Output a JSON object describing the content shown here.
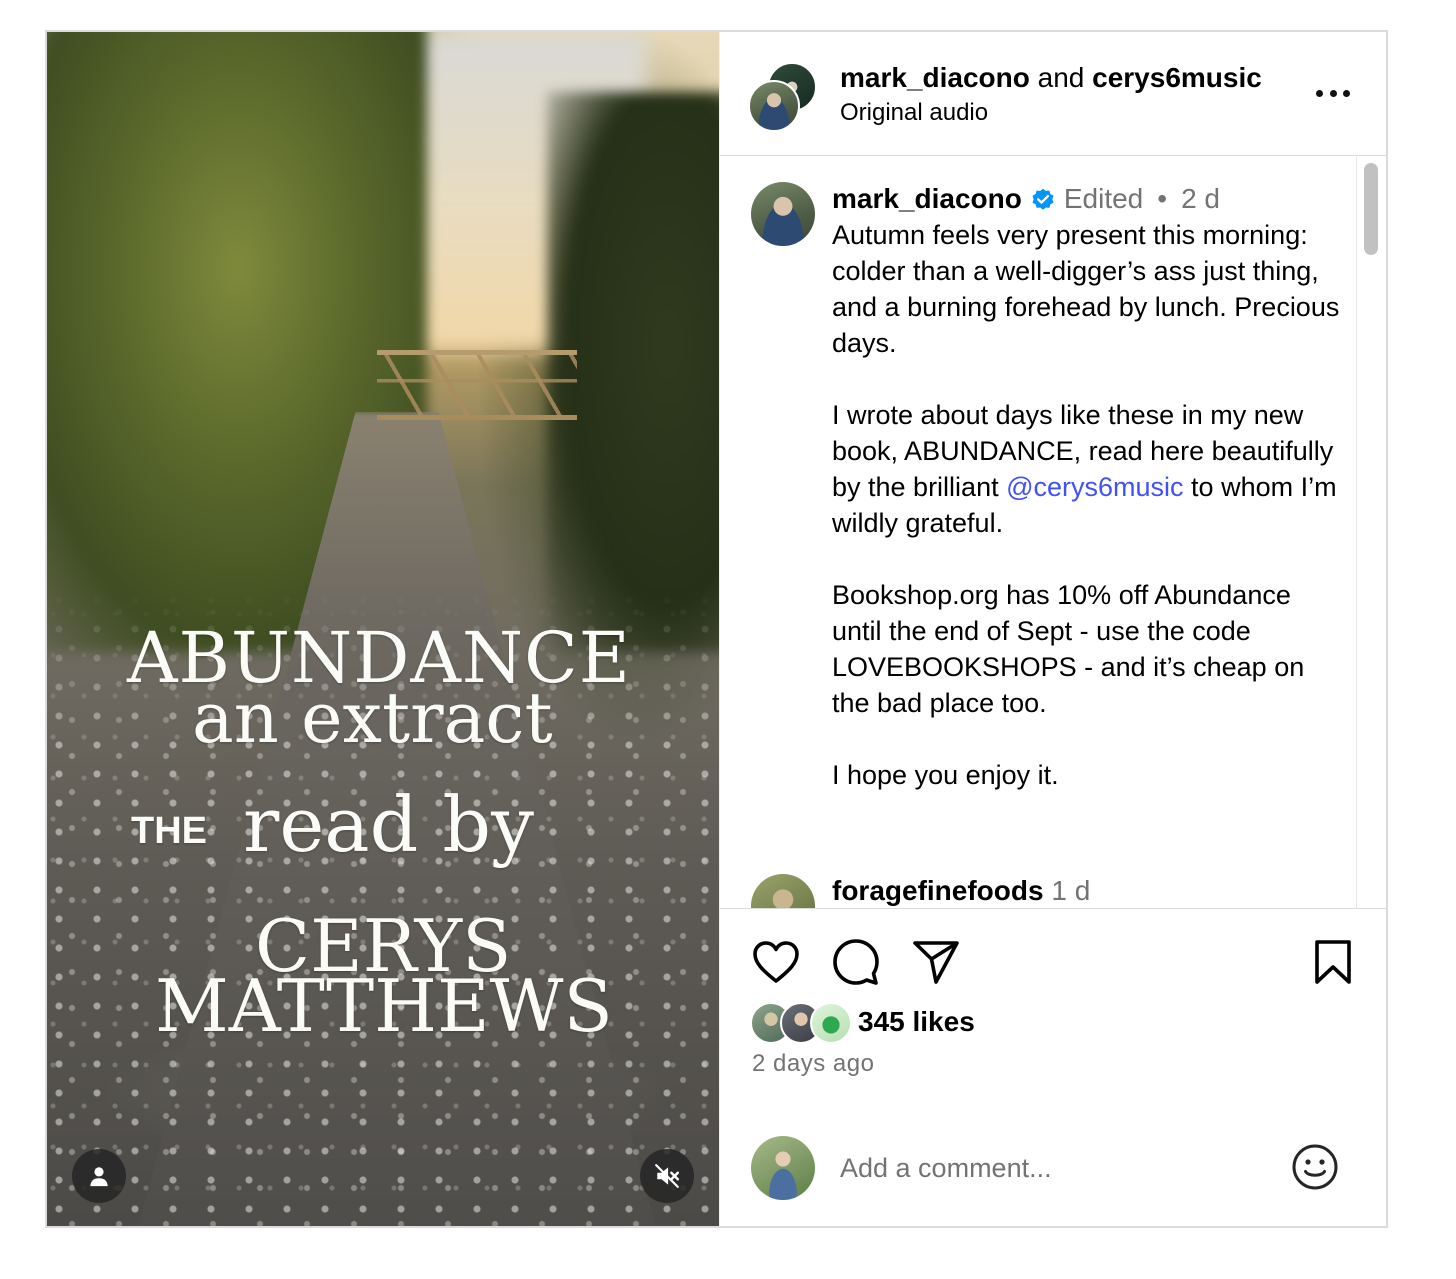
{
  "header": {
    "user1": "mark_diacono",
    "joiner": "and",
    "user2": "cerys6music",
    "audio": "Original audio"
  },
  "media": {
    "overlay_lines": [
      "ABUNDANCE",
      "an extract",
      "THE",
      "read by",
      "CERYS",
      "MATTHEWS"
    ],
    "user_button_icon": "person-icon",
    "mute_button_icon": "speaker-muted-icon"
  },
  "caption": {
    "username": "mark_diacono",
    "verified": true,
    "edited": "Edited",
    "dot": "•",
    "time": "2 d",
    "para1": "Autumn feels very present this morning: colder than a well-digger’s ass just thing, and a burning forehead by lunch. Precious days.",
    "para2_before": "I wrote about days like these in my new book, ABUNDANCE, read here beautifully by the brilliant ",
    "para2_mention": "@cerys6music",
    "para2_after": " to whom I’m wildly grateful.",
    "para3": "Bookshop.org has 10% off Abundance until the end of Sept - use the code LOVEBOOKSHOPS - and it’s cheap on the bad place too.",
    "para4": "I hope you enjoy it."
  },
  "comments": [
    {
      "username": "foragefinefoods",
      "time": "1 d"
    }
  ],
  "actions": {
    "likes": "345 likes",
    "time_ago": "2 days ago"
  },
  "comment_box": {
    "placeholder": "Add a comment..."
  },
  "colors": {
    "mention": "#4150f7",
    "verified_badge": "#0095f6",
    "secondary_text": "#737373",
    "border": "#dbdbdb"
  }
}
